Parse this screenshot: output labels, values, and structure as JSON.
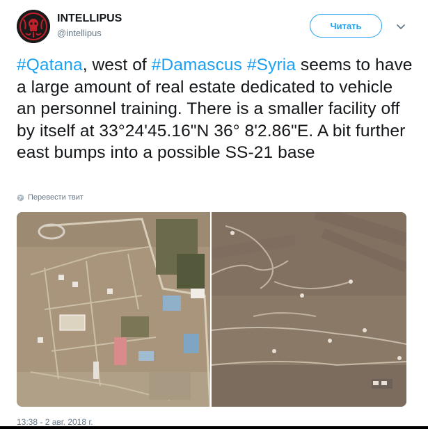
{
  "header": {
    "display_name": "INTELLIPUS",
    "handle": "@intellipus",
    "follow_label": "Читать",
    "avatar_icon": "hydra-logo-icon",
    "menu_icon": "chevron-down-icon"
  },
  "tweet": {
    "segments": [
      {
        "text": "#Qatana",
        "hashtag": true
      },
      {
        "text": ", west of ",
        "hashtag": false
      },
      {
        "text": "#Damascus",
        "hashtag": true
      },
      {
        "text": " ",
        "hashtag": false
      },
      {
        "text": "#Syria",
        "hashtag": true
      },
      {
        "text": " seems to have a large amount of real estate dedicated to vehicle an personnel training. There is a smaller facility off by itself at  33°24'45.16\"N 36° 8'2.86\"E. A bit further east bumps into a possible SS-21 base",
        "hashtag": false
      }
    ],
    "translate_label": "Перевести твит",
    "timestamp": "13:38 - 2 авг. 2018 г."
  },
  "colors": {
    "link": "#1da1f2",
    "text": "#14171a",
    "muted": "#657786",
    "avatar_bg": "#1a1a1a",
    "logo_red": "#c0202a"
  },
  "media": [
    {
      "name": "satellite-image-training-facility"
    },
    {
      "name": "satellite-image-possible-ss21-base"
    }
  ]
}
